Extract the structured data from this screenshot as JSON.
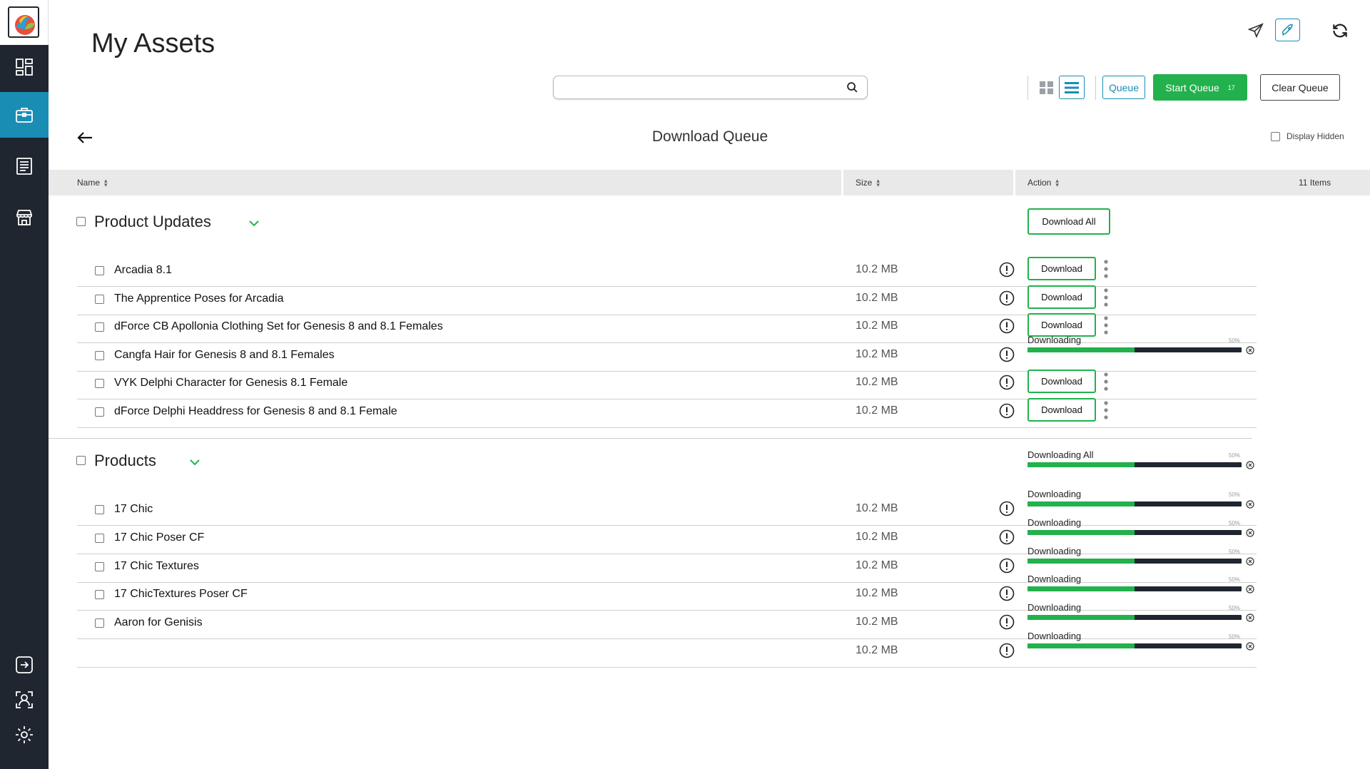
{
  "app": {
    "title": "My Assets"
  },
  "sidebar": {
    "items": [
      {
        "icon": "dashboard-icon"
      },
      {
        "icon": "briefcase-icon",
        "active": true
      },
      {
        "icon": "document-list-icon"
      },
      {
        "icon": "store-icon"
      },
      {
        "icon": "logout-icon"
      },
      {
        "icon": "user-account-icon"
      },
      {
        "icon": "gear-icon"
      }
    ]
  },
  "toolbar": {
    "search_placeholder": "",
    "queue_label": "Queue",
    "start_queue_label": "Start Queue",
    "start_queue_count": "17",
    "clear_queue_label": "Clear Queue"
  },
  "queue": {
    "title": "Download Queue",
    "display_hidden_label": "Display Hidden"
  },
  "table": {
    "col_name": "Name",
    "col_size": "Size",
    "col_action": "Action",
    "items_count": "11 Items"
  },
  "groups": [
    {
      "title": "Product Updates",
      "download_all_label": "Download All",
      "rows": [
        {
          "name": "Arcadia 8.1",
          "size": "10.2 MB",
          "action": "Download"
        },
        {
          "name": "The Apprentice Poses for Arcadia",
          "size": "10.2 MB",
          "action": "Download"
        },
        {
          "name": "dForce CB Apollonia Clothing Set for Genesis 8 and 8.1 Females",
          "size": "10.2 MB",
          "action": "Download"
        },
        {
          "name": "Cangfa Hair for Genesis 8 and 8.1 Females",
          "size": "10.2 MB",
          "action": "Downloading",
          "progress_label": "50%",
          "progress": 0.5
        },
        {
          "name": "VYK Delphi Character for Genesis 8.1 Female",
          "size": "10.2 MB",
          "action": "Download"
        },
        {
          "name": "dForce Delphi Headdress for Genesis 8 and 8.1 Female",
          "size": "10.2 MB",
          "action": "Download"
        }
      ]
    },
    {
      "title": "Products",
      "downloading_all_label": "Downloading All",
      "downloading_all_pct": "50%",
      "downloading_all_progress": 0.5,
      "rows": [
        {
          "name": "17 Chic",
          "size": "10.2 MB",
          "action": "Downloading",
          "progress_label": "50%",
          "progress": 0.5
        },
        {
          "name": "17 Chic Poser CF",
          "size": "10.2 MB",
          "action": "Downloading",
          "progress_label": "50%",
          "progress": 0.5
        },
        {
          "name": "17 Chic Textures",
          "size": "10.2 MB",
          "action": "Downloading",
          "progress_label": "50%",
          "progress": 0.5
        },
        {
          "name": "17 ChicTextures Poser CF",
          "size": "10.2 MB",
          "action": "Downloading",
          "progress_label": "50%",
          "progress": 0.5
        },
        {
          "name": "Aaron for Genisis",
          "size": "10.2 MB",
          "action": "Downloading",
          "progress_label": "50%",
          "progress": 0.5
        },
        {
          "name": "",
          "size": "10.2 MB",
          "action": "Downloading",
          "progress_label": "50%",
          "progress": 0.5
        }
      ]
    }
  ],
  "colors": {
    "accent": "#1a8db5",
    "success": "#22b14c",
    "sidebar": "#1f2630"
  }
}
